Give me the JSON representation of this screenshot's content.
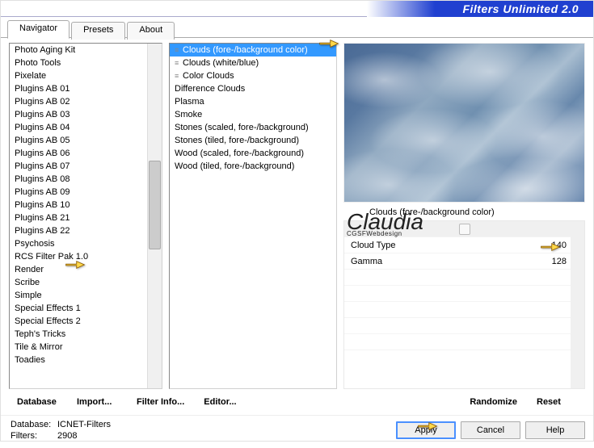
{
  "title": "Filters Unlimited 2.0",
  "tabs": [
    "Navigator",
    "Presets",
    "About"
  ],
  "active_tab": 0,
  "categories": [
    "Photo Aging Kit",
    "Photo Tools",
    "Pixelate",
    "Plugins AB 01",
    "Plugins AB 02",
    "Plugins AB 03",
    "Plugins AB 04",
    "Plugins AB 05",
    "Plugins AB 06",
    "Plugins AB 07",
    "Plugins AB 08",
    "Plugins AB 09",
    "Plugins AB 10",
    "Plugins AB 21",
    "Plugins AB 22",
    "Psychosis",
    "RCS Filter Pak 1.0",
    "Render",
    "Scribe",
    "Simple",
    "Special Effects 1",
    "Special Effects 2",
    "Teph's Tricks",
    "Tile & Mirror",
    "Toadies"
  ],
  "selected_category_index": 17,
  "filters": [
    {
      "label": "Clouds (fore-/background color)",
      "striped": true
    },
    {
      "label": "Clouds (white/blue)",
      "striped": true
    },
    {
      "label": "Color Clouds",
      "striped": true
    },
    {
      "label": "Difference Clouds",
      "striped": false
    },
    {
      "label": "Plasma",
      "striped": false
    },
    {
      "label": "Smoke",
      "striped": false
    },
    {
      "label": "Stones (scaled, fore-/background)",
      "striped": false
    },
    {
      "label": "Stones (tiled, fore-/background)",
      "striped": false
    },
    {
      "label": "Wood (scaled, fore-/background)",
      "striped": false
    },
    {
      "label": "Wood (tiled, fore-/background)",
      "striped": false
    }
  ],
  "selected_filter_index": 0,
  "current_filter_name": "Clouds (fore-/background color)",
  "params": [
    {
      "name": "Cloud Type",
      "value": 140,
      "max": 255
    },
    {
      "name": "Gamma",
      "value": 128,
      "max": 255
    }
  ],
  "toolbar": {
    "database": "Database",
    "import": "Import...",
    "filter_info": "Filter Info...",
    "editor": "Editor...",
    "randomize": "Randomize",
    "reset": "Reset"
  },
  "buttons": {
    "apply": "Apply",
    "cancel": "Cancel",
    "help": "Help"
  },
  "status": {
    "db_key": "Database:",
    "db_val": "ICNET-Filters",
    "flt_key": "Filters:",
    "flt_val": "2908"
  }
}
